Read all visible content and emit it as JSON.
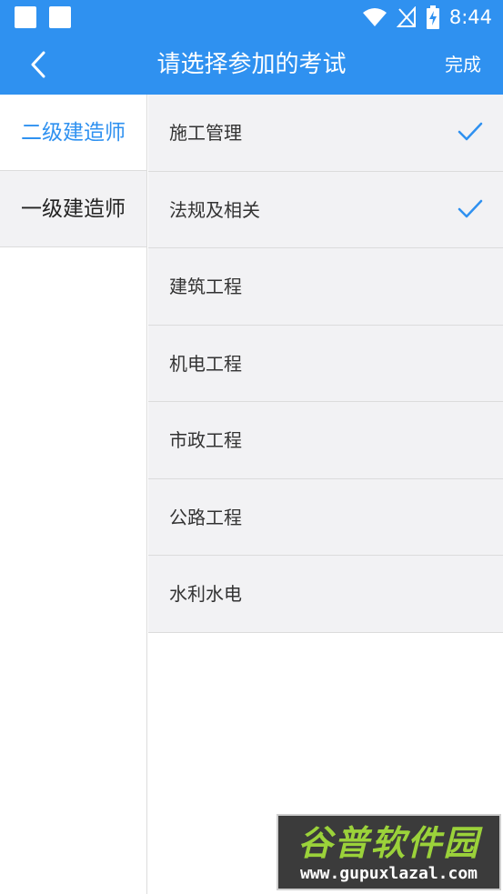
{
  "status_bar": {
    "time": "8:44",
    "icons": [
      "notification-square-icon",
      "notification-square-icon",
      "wifi-icon",
      "no-signal-icon",
      "battery-charging-icon"
    ]
  },
  "app_bar": {
    "back_icon": "chevron-left-icon",
    "title": "请选择参加的考试",
    "done_label": "完成"
  },
  "categories": [
    {
      "label": "二级建造师",
      "selected": true
    },
    {
      "label": "一级建造师",
      "selected": false
    }
  ],
  "subjects": [
    {
      "label": "施工管理",
      "checked": true
    },
    {
      "label": "法规及相关",
      "checked": true
    },
    {
      "label": "建筑工程",
      "checked": false
    },
    {
      "label": "机电工程",
      "checked": false
    },
    {
      "label": "市政工程",
      "checked": false
    },
    {
      "label": "公路工程",
      "checked": false
    },
    {
      "label": "水利水电",
      "checked": false
    }
  ],
  "watermark": {
    "name": "谷普软件园",
    "url": "www.gupuxlazal.com"
  },
  "colors": {
    "accent": "#2f91f0",
    "row_bg": "#f2f2f4",
    "divider": "#dcdcdc"
  }
}
